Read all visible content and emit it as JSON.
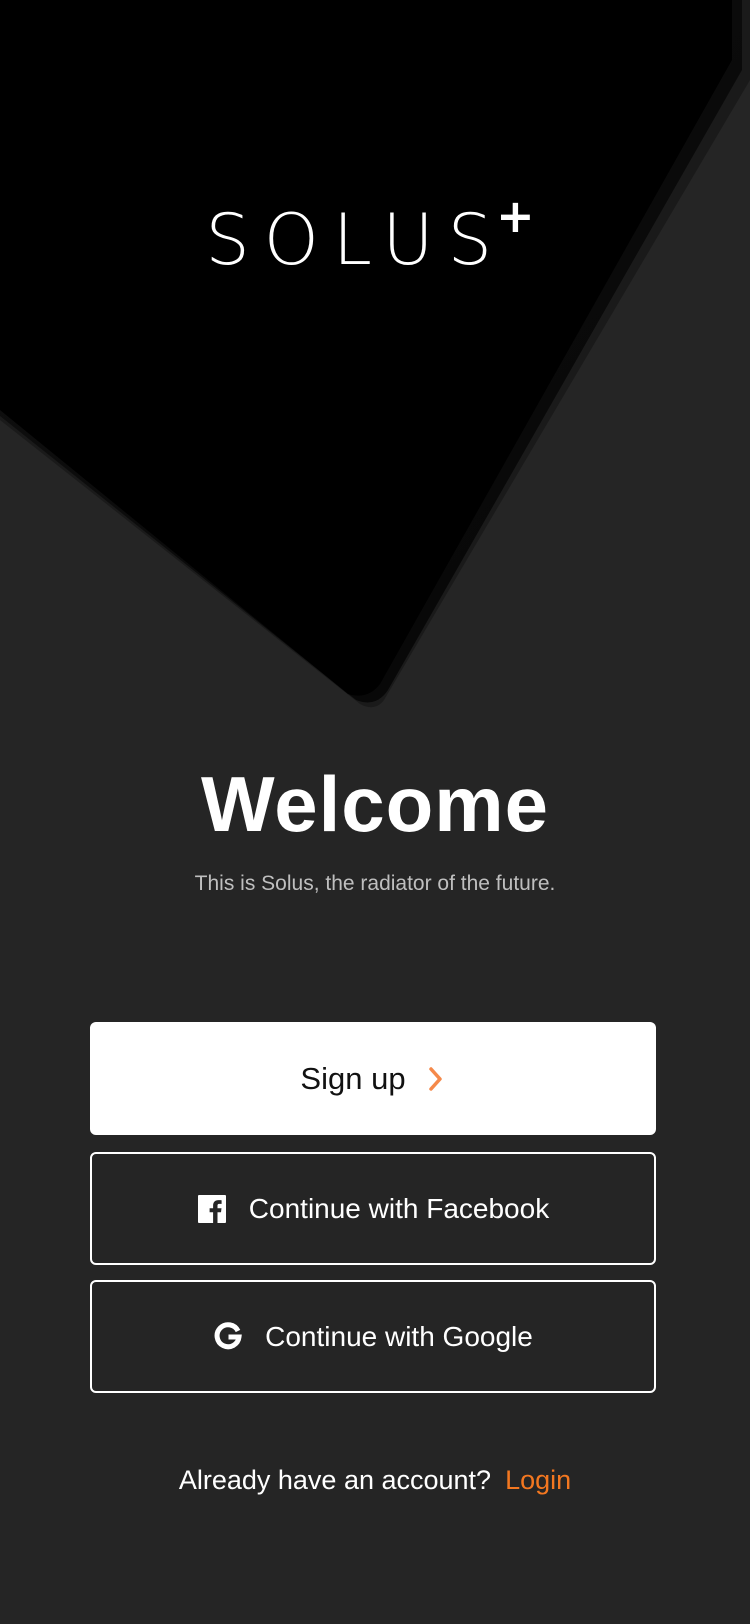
{
  "brand": {
    "logo_word": "SOLUS",
    "logo_plus": "+"
  },
  "welcome": {
    "title": "Welcome",
    "subtitle": "This is Solus, the radiator of the future."
  },
  "actions": {
    "signup_label": "Sign up",
    "facebook_label": "Continue with Facebook",
    "google_label": "Continue with Google"
  },
  "footer": {
    "prompt": "Already have an account?",
    "login_label": "Login"
  },
  "icons": {
    "signup": "chevron-right-icon",
    "facebook": "facebook-icon",
    "google": "google-icon"
  },
  "colors": {
    "background": "#252525",
    "hero": "#000000",
    "accent": "#f37720",
    "primary_button": "#ffffff"
  }
}
